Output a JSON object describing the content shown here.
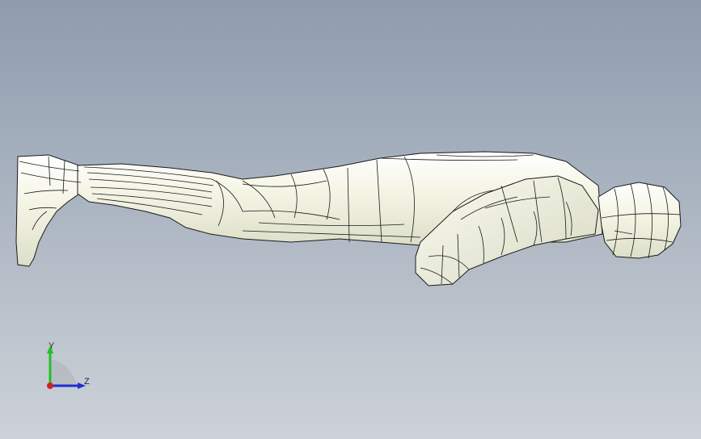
{
  "viewport": {
    "background_top": "#8e9cae",
    "background_bottom": "#cdd2d8",
    "model_fill": "#f4f4e6",
    "model_shade": "#d9dcc6",
    "model_edge": "#1a1a1a"
  },
  "model": {
    "icon": "human-mannequin-part"
  },
  "triad": {
    "y_label": "Y",
    "z_label": "Z",
    "y_color": "#22c022",
    "z_color": "#2030d0",
    "x_color": "#d02020"
  }
}
